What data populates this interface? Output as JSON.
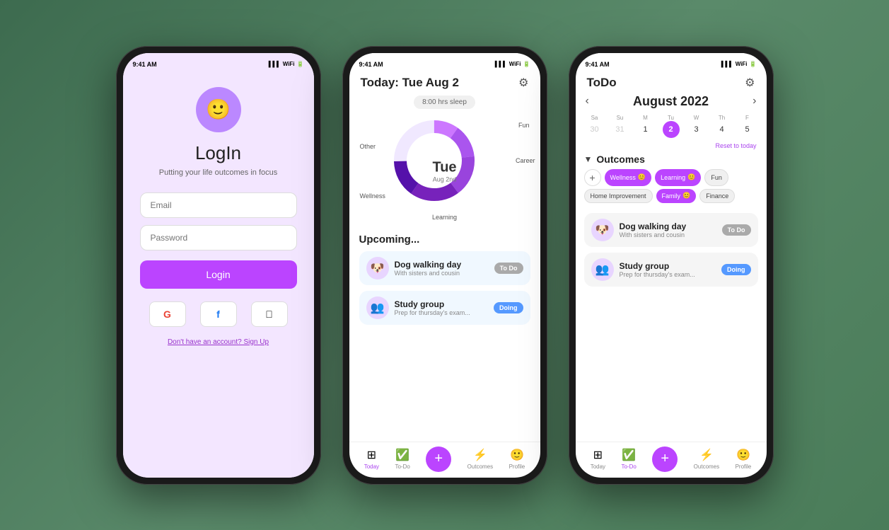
{
  "phone1": {
    "status_time": "9:41 AM",
    "avatar_emoji": "🙂",
    "title": "LogIn",
    "subtitle": "Putting your life outcomes in focus",
    "email_placeholder": "Email",
    "password_placeholder": "Password",
    "login_btn": "Login",
    "google_icon": "G",
    "facebook_icon": "f",
    "apple_icon": "",
    "signup_text": "Don't have an account? Sign Up"
  },
  "phone2": {
    "status_time": "9:41 AM",
    "header_title": "Today: Tue Aug 2",
    "sleep_badge": "8:00 hrs sleep",
    "donut_center_day": "Tue",
    "donut_center_date": "Aug 2nd",
    "labels": {
      "fun": "Fun",
      "career": "Career",
      "learning": "Learning",
      "wellness": "Wellness",
      "other": "Other"
    },
    "upcoming_title": "Upcoming...",
    "tasks": [
      {
        "name": "Dog walking day",
        "sub": "With sisters and cousin",
        "badge": "To Do",
        "badge_type": "todo",
        "icon": "🐶",
        "card_type": "blue"
      },
      {
        "name": "Study group",
        "sub": "Prep for thursday's exam...",
        "badge": "Doing",
        "badge_type": "doing",
        "icon": "👥",
        "card_type": "blue"
      }
    ],
    "nav": {
      "today": "Today",
      "todo": "To-Do",
      "outcomes": "Outcomes",
      "profile": "Profile"
    }
  },
  "phone3": {
    "status_time": "9:41 AM",
    "header_title": "ToDo",
    "calendar_month": "August 2022",
    "calendar_days": [
      {
        "name": "Sa",
        "num": "30",
        "muted": true
      },
      {
        "name": "Su",
        "num": "31",
        "muted": true
      },
      {
        "name": "M",
        "num": "1",
        "muted": false
      },
      {
        "name": "Tu",
        "num": "2",
        "today": true
      },
      {
        "name": "W",
        "num": "3",
        "muted": false
      },
      {
        "name": "Th",
        "num": "4",
        "muted": false
      },
      {
        "name": "F",
        "num": "5",
        "muted": false
      }
    ],
    "reset_today": "Reset to today",
    "outcomes_title": "Outcomes",
    "chips_row1": [
      {
        "label": "Wellness",
        "type": "purple",
        "emoji": "😊"
      },
      {
        "label": "Learning",
        "type": "purple",
        "emoji": "😊"
      },
      {
        "label": "Fun",
        "type": "gray"
      }
    ],
    "chips_row2": [
      {
        "label": "Home Improvement",
        "type": "gray"
      },
      {
        "label": "Family",
        "type": "purple",
        "emoji": "😊"
      },
      {
        "label": "Finance",
        "type": "gray"
      }
    ],
    "tasks": [
      {
        "name": "Dog walking day",
        "sub": "With sisters and cousin",
        "badge": "To Do",
        "badge_type": "todo",
        "icon": "🐶"
      },
      {
        "name": "Study group",
        "sub": "Prep for thursday's exam...",
        "badge": "Doing",
        "badge_type": "doing",
        "icon": "👥"
      }
    ],
    "nav": {
      "today": "Today",
      "todo": "To-Do",
      "outcomes": "Outcomes",
      "profile": "Profile"
    }
  }
}
